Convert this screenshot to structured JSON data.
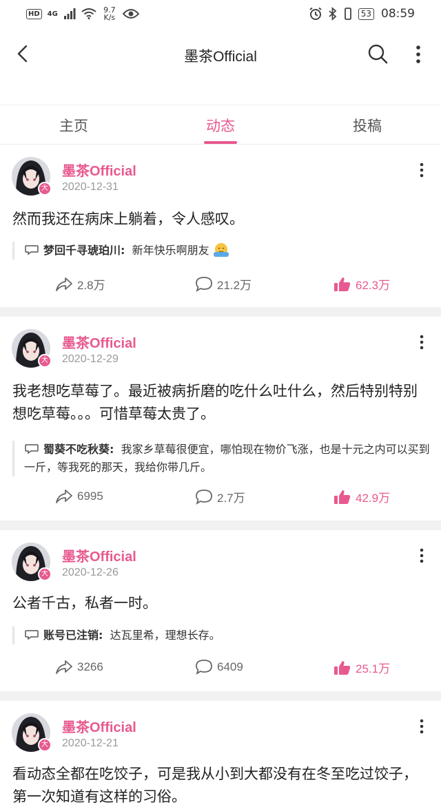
{
  "status_bar": {
    "hd": "HD",
    "network": "4G",
    "speed_value": "9.7",
    "speed_unit": "K/s",
    "battery": "53",
    "time": "08:59"
  },
  "header": {
    "title": "墨茶Official"
  },
  "tabs": [
    {
      "label": "主页",
      "active": false
    },
    {
      "label": "动态",
      "active": true
    },
    {
      "label": "投稿",
      "active": false
    }
  ],
  "accent_color": "#e8598f",
  "posts": [
    {
      "author": "墨茶Official",
      "date": "2020-12-31",
      "text": "然而我还在病床上躺着，令人感叹。",
      "reply_name": "梦回千寻琥珀川:",
      "reply_text": "新年快乐啊朋友",
      "shares": "2.8万",
      "comments": "21.2万",
      "likes": "62.3万"
    },
    {
      "author": "墨茶Official",
      "date": "2020-12-29",
      "text": "我老想吃草莓了。最近被病折磨的吃什么吐什么，然后特别特别想吃草莓。。。可惜草莓太贵了。",
      "reply_name": "蜀葵不吃秋葵:",
      "reply_text": "我家乡草莓很便宜，哪怕现在物价飞涨，也是十元之内可以买到一斤，等我死的那天，我给你带几斤。",
      "shares": "6995",
      "comments": "2.7万",
      "likes": "42.9万"
    },
    {
      "author": "墨茶Official",
      "date": "2020-12-26",
      "text": "公者千古，私者一时。",
      "reply_name": "账号已注销:",
      "reply_text": "达瓦里希，理想长存。",
      "shares": "3266",
      "comments": "6409",
      "likes": "25.1万"
    },
    {
      "author": "墨茶Official",
      "date": "2020-12-21",
      "text": "看动态全都在吃饺子，可是我从小到大都没有在冬至吃过饺子，第一次知道有这样的习俗。"
    }
  ]
}
